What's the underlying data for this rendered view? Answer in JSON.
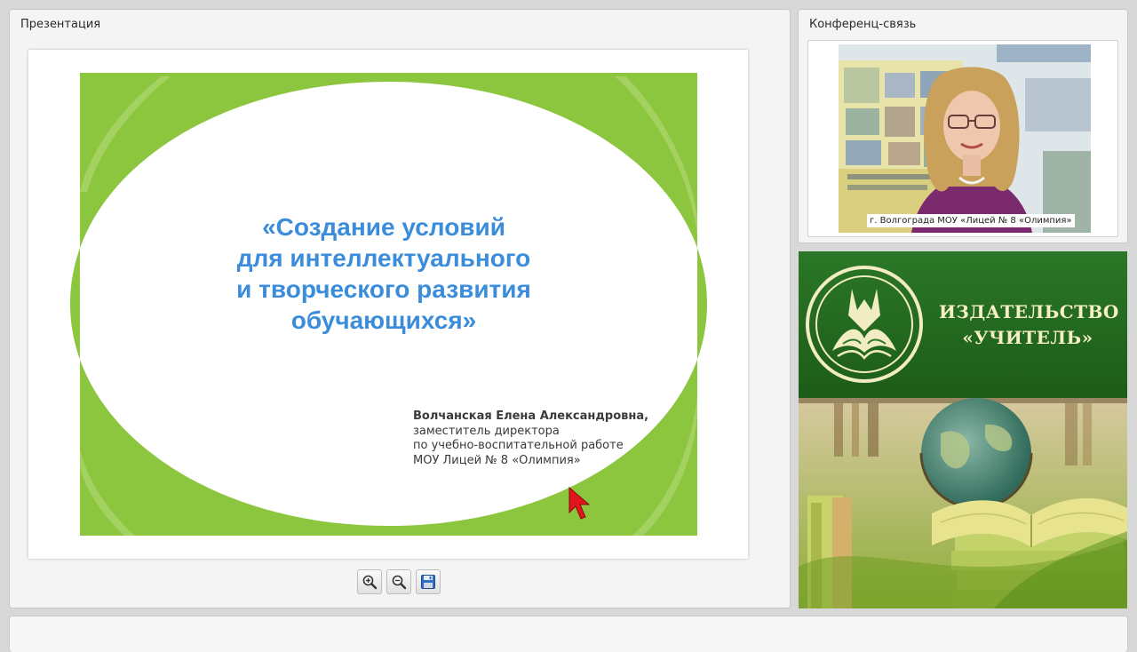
{
  "presentation": {
    "title": "Презентация",
    "slide": {
      "title_lines": [
        "«Создание условий",
        "для интеллектуального",
        "и творческого развития",
        "обучающихся»"
      ],
      "author_lines": [
        "Волчанская Елена Александровна,",
        "заместитель директора",
        "по учебно-воспитательной работе",
        "МОУ Лицей № 8 «Олимпия»"
      ]
    },
    "toolbar": {
      "zoom_in_icon": "zoom-in-icon",
      "zoom_out_icon": "zoom-out-icon",
      "save_icon": "floppy-disk-icon"
    }
  },
  "conference": {
    "title": "Конференц-связь",
    "video_caption": "г. Волгограда МОУ «Лицей № 8 «Олимпия»"
  },
  "publisher": {
    "name_lines": [
      "ИЗДАТЕЛЬСТВО",
      "«УЧИТЕЛЬ»"
    ]
  },
  "colors": {
    "slide_accent_green": "#8cc63f",
    "slide_title_blue": "#3b8ddb",
    "publisher_green": "#2b7727",
    "publisher_text": "#f5efc7",
    "cursor_red": "#e0161c"
  }
}
